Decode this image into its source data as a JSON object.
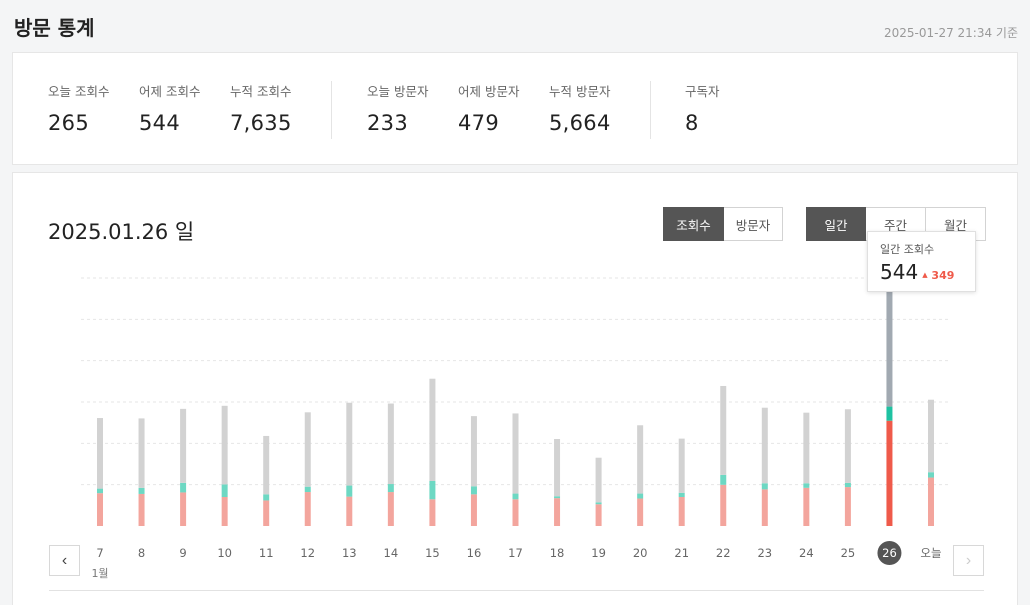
{
  "header": {
    "title": "방문 통계",
    "timestamp": "2025-01-27 21:34 기준"
  },
  "summary": [
    {
      "label": "오늘 조회수",
      "value": "265"
    },
    {
      "label": "어제 조회수",
      "value": "544"
    },
    {
      "label": "누적 조회수",
      "value": "7,635"
    },
    {
      "label": "오늘 방문자",
      "value": "233"
    },
    {
      "label": "어제 방문자",
      "value": "479"
    },
    {
      "label": "누적 방문자",
      "value": "5,664"
    },
    {
      "label": "구독자",
      "value": "8"
    }
  ],
  "chart_section": {
    "date_title": "2025.01.26 일",
    "metric_tabs": [
      {
        "label": "조회수",
        "active": true
      },
      {
        "label": "방문자",
        "active": false
      }
    ],
    "period_tabs": [
      {
        "label": "일간",
        "active": true
      },
      {
        "label": "주간",
        "active": false
      },
      {
        "label": "월간",
        "active": false
      }
    ],
    "tooltip": {
      "label": "일간 조회수",
      "value": "544",
      "change": "349"
    },
    "nav": {
      "prev": "‹",
      "next": "›"
    }
  },
  "colors": {
    "bar_gray": "#d2d2d2",
    "bar_teal": "#6dd8c3",
    "bar_red": "#f3a59d",
    "selected_gray": "#a1a9b1",
    "selected_teal": "#1fc2a2",
    "selected_red": "#ef5a4a",
    "accent_red": "#ef5a4a"
  },
  "chart_data": {
    "type": "bar",
    "stacked": true,
    "categories": [
      "7",
      "8",
      "9",
      "10",
      "11",
      "12",
      "13",
      "14",
      "15",
      "16",
      "17",
      "18",
      "19",
      "20",
      "21",
      "22",
      "23",
      "24",
      "25",
      "26",
      "오늘"
    ],
    "month_label": "1월",
    "selected_category": "26",
    "series": [
      {
        "values": [
          185,
          182,
          194,
          206,
          153,
          195,
          217,
          211,
          268,
          184,
          210,
          150,
          117,
          179,
          142,
          233,
          198,
          185,
          193,
          349,
          190
        ]
      },
      {
        "values": [
          12,
          16,
          25,
          33,
          16,
          14,
          29,
          21,
          48,
          21,
          15,
          5,
          5,
          13,
          11,
          26,
          16,
          12,
          11,
          37,
          14
        ]
      },
      {
        "values": [
          86,
          84,
          88,
          76,
          67,
          89,
          77,
          89,
          70,
          83,
          70,
          73,
          57,
          72,
          76,
          108,
          96,
          100,
          102,
          276,
          127
        ]
      }
    ],
    "ylim": [
      0,
      650
    ],
    "grid": true
  }
}
